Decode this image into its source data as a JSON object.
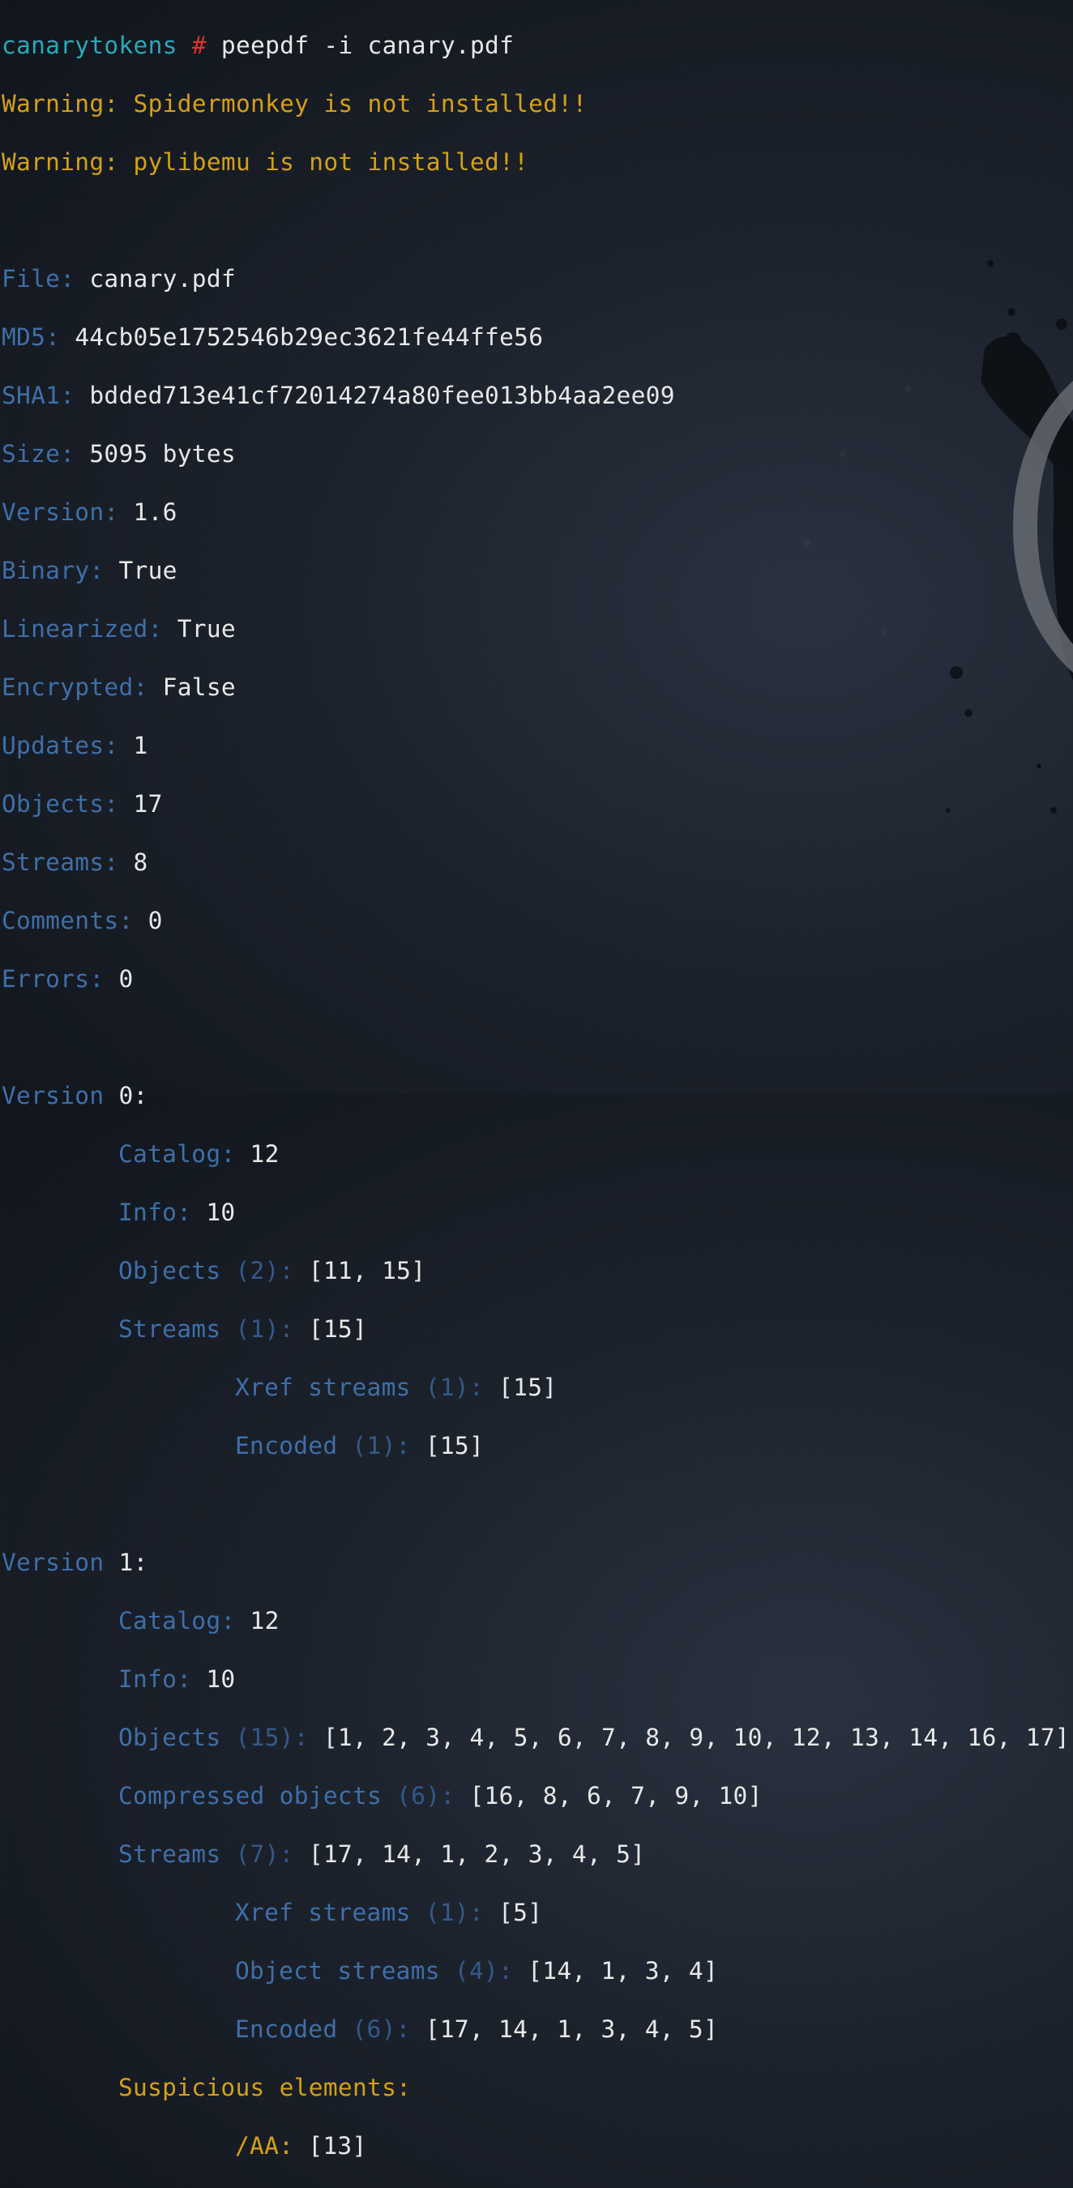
{
  "prompt": {
    "host": "canarytokens",
    "symbol": "#",
    "command": "peepdf -i canary.pdf"
  },
  "warnings": [
    "Warning: Spidermonkey is not installed!!",
    "Warning: pylibemu is not installed!!"
  ],
  "summary": [
    {
      "key": "File:",
      "value": "canary.pdf"
    },
    {
      "key": "MD5:",
      "value": "44cb05e1752546b29ec3621fe44ffe56"
    },
    {
      "key": "SHA1:",
      "value": "bdded713e41cf72014274a80fee013bb4aa2ee09"
    },
    {
      "key": "Size:",
      "value": "5095 bytes"
    },
    {
      "key": "Version:",
      "value": "1.6"
    },
    {
      "key": "Binary:",
      "value": "True"
    },
    {
      "key": "Linearized:",
      "value": "True"
    },
    {
      "key": "Encrypted:",
      "value": "False"
    },
    {
      "key": "Updates:",
      "value": "1"
    },
    {
      "key": "Objects:",
      "value": "17"
    },
    {
      "key": "Streams:",
      "value": "8"
    },
    {
      "key": "Comments:",
      "value": "0"
    },
    {
      "key": "Errors:",
      "value": "0"
    }
  ],
  "version0": {
    "label": "Version",
    "number": "0:",
    "catalog": {
      "key": "Catalog:",
      "value": "12"
    },
    "info": {
      "key": "Info:",
      "value": "10"
    },
    "objects": {
      "key": "Objects",
      "count": "(2):",
      "value": "[11, 15]"
    },
    "streams": {
      "key": "Streams",
      "count": "(1):",
      "value": "[15]"
    },
    "xref_streams": {
      "key": "Xref streams",
      "count": "(1):",
      "value": "[15]"
    },
    "encoded": {
      "key": "Encoded",
      "count": "(1):",
      "value": "[15]"
    }
  },
  "version1": {
    "label": "Version",
    "number": "1:",
    "catalog": {
      "key": "Catalog:",
      "value": "12"
    },
    "info": {
      "key": "Info:",
      "value": "10"
    },
    "objects": {
      "key": "Objects",
      "count": "(15):",
      "value": "[1, 2, 3, 4, 5, 6, 7, 8, 9, 10, 12, 13, 14, 16, 17]"
    },
    "compressed": {
      "key": "Compressed objects",
      "count": "(6):",
      "value": "[16, 8, 6, 7, 9, 10]"
    },
    "streams": {
      "key": "Streams",
      "count": "(7):",
      "value": "[17, 14, 1, 2, 3, 4, 5]"
    },
    "xref_streams": {
      "key": "Xref streams",
      "count": "(1):",
      "value": "[5]"
    },
    "object_streams": {
      "key": "Object streams",
      "count": "(4):",
      "value": "[14, 1, 3, 4]"
    },
    "encoded": {
      "key": "Encoded",
      "count": "(6):",
      "value": "[17, 14, 1, 3, 4, 5]"
    },
    "suspicious_label": "Suspicious elements:",
    "suspicious_aa": {
      "key": "/AA:",
      "value": "[13]"
    }
  }
}
